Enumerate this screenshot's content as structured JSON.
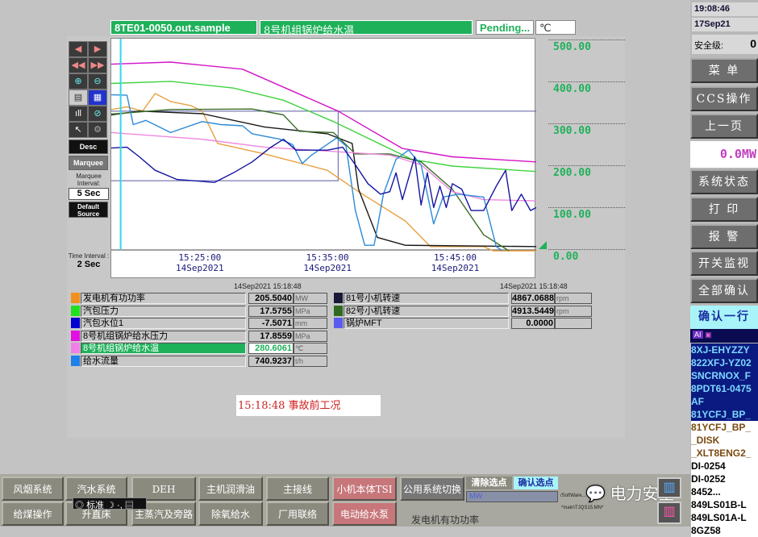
{
  "header": {
    "tag": "8TE01-0050.out.sample",
    "description": "8号机组锅炉给水温",
    "status": "Pending...",
    "unit": "℃"
  },
  "toolbar": {
    "desc": "Desc",
    "marquee": "Marquee",
    "marquee_interval_label": "Marquee Interval:",
    "marquee_interval": "5 Sec",
    "default_source": "Default Source",
    "time_interval_label": "Time Interval :",
    "time_interval": "2 Sec"
  },
  "chart_data": {
    "type": "line",
    "ylim": [
      0,
      500
    ],
    "xlim": [
      "15:18:00",
      "15:51:17"
    ],
    "y_ticks": [
      "0.00",
      "100.00",
      "200.00",
      "300.00",
      "400.00",
      "500.00"
    ],
    "x_ticks": [
      {
        "time": "15:25:00",
        "date": "14Sep2021"
      },
      {
        "time": "15:35:00",
        "date": "14Sep2021"
      },
      {
        "time": "15:45:00",
        "date": "14Sep2021"
      }
    ],
    "cursor_time": "15:18:44",
    "series": [
      {
        "name": "8号机组锅炉给水压力",
        "color": "#d214c8",
        "points": [
          [
            "15:18:00",
            445
          ],
          [
            "15:22:39",
            450
          ],
          [
            "15:28:17",
            433
          ],
          [
            "15:35:46",
            333
          ],
          [
            "15:40:48",
            244
          ],
          [
            "15:44:43",
            224
          ],
          [
            "15:51:17",
            212
          ]
        ]
      },
      {
        "name": "汽包压力",
        "color": "#3fd23f",
        "points": [
          [
            "15:18:00",
            399
          ],
          [
            "15:22:39",
            404
          ],
          [
            "15:27:34",
            388
          ],
          [
            "15:31:29",
            359
          ],
          [
            "15:35:24",
            308
          ],
          [
            "15:41:32",
            218
          ],
          [
            "15:44:43",
            202
          ],
          [
            "15:51:17",
            189
          ]
        ]
      },
      {
        "name": "发电机有功功率",
        "color": "#e8a040",
        "points": [
          [
            "15:18:00",
            337
          ],
          [
            "15:19:14",
            343
          ],
          [
            "15:20:27",
            333
          ],
          [
            "15:21:26",
            375
          ],
          [
            "15:22:39",
            356
          ],
          [
            "15:24:15",
            346
          ],
          [
            "15:25:07",
            333
          ],
          [
            "15:26:20",
            256
          ],
          [
            "15:30:01",
            231
          ],
          [
            "15:34:55",
            192
          ],
          [
            "15:37:22",
            141
          ],
          [
            "15:41:02",
            71
          ],
          [
            "15:43:00",
            10
          ],
          [
            "15:47:10",
            10
          ],
          [
            "15:47:54",
            0
          ],
          [
            "15:51:17",
            0
          ]
        ]
      },
      {
        "name": "81号小机转速",
        "color": "#1a1a1a",
        "points": [
          [
            "15:18:00",
            324
          ],
          [
            "15:20:12",
            333
          ],
          [
            "15:25:07",
            327
          ],
          [
            "15:30:01",
            295
          ],
          [
            "15:34:55",
            279
          ],
          [
            "15:36:52",
            256
          ],
          [
            "15:37:22",
            147
          ],
          [
            "15:38:50",
            32
          ],
          [
            "15:41:02",
            13
          ],
          [
            "15:51:17",
            10
          ]
        ]
      },
      {
        "name": "82号小机转速",
        "color": "#3c6e28",
        "points": [
          [
            "15:18:00",
            326
          ],
          [
            "15:22:39",
            337
          ],
          [
            "15:29:02",
            338
          ],
          [
            "15:31:29",
            324
          ],
          [
            "15:32:42",
            285
          ],
          [
            "15:35:24",
            282
          ],
          [
            "15:37:07",
            231
          ],
          [
            "15:39:49",
            231
          ],
          [
            "15:42:16",
            212
          ],
          [
            "15:44:43",
            147
          ],
          [
            "15:47:10",
            38
          ],
          [
            "15:49:08",
            0
          ]
        ]
      },
      {
        "name": "8号机组锅炉给水温",
        "color": "#ee88e0",
        "points": [
          [
            "15:18:00",
            282
          ],
          [
            "15:25:07",
            266
          ],
          [
            "15:30:01",
            247
          ],
          [
            "15:36:52",
            234
          ],
          [
            "15:39:49",
            228
          ],
          [
            "15:42:16",
            205
          ],
          [
            "15:44:43",
            141
          ],
          [
            "15:47:10",
            122
          ],
          [
            "15:51:17",
            119
          ]
        ]
      },
      {
        "name": "给水流量",
        "color": "#2a8ad8",
        "points": [
          [
            "15:18:00",
            372
          ],
          [
            "15:19:14",
            371
          ],
          [
            "15:19:43",
            301
          ],
          [
            "15:20:42",
            311
          ],
          [
            "15:22:39",
            282
          ],
          [
            "15:25:07",
            308
          ],
          [
            "15:26:35",
            301
          ],
          [
            "15:28:17",
            298
          ],
          [
            "15:29:02",
            279
          ],
          [
            "15:31:14",
            266
          ],
          [
            "15:32:13",
            253
          ],
          [
            "15:32:57",
            208
          ],
          [
            "15:33:41",
            228
          ],
          [
            "15:35:39",
            269
          ],
          [
            "15:36:23",
            250
          ],
          [
            "15:37:07",
            96
          ],
          [
            "15:37:51",
            13
          ],
          [
            "15:38:35",
            13
          ],
          [
            "15:39:19",
            135
          ],
          [
            "15:40:18",
            218
          ],
          [
            "15:41:17",
            240
          ],
          [
            "15:42:16",
            205
          ],
          [
            "15:43:15",
            64
          ],
          [
            "15:43:59",
            128
          ],
          [
            "15:45:12",
            135
          ],
          [
            "15:47:10",
            128
          ],
          [
            "15:48:09",
            10
          ],
          [
            "15:48:38",
            0
          ]
        ]
      },
      {
        "name": "汽包水位1",
        "color": "#1414a0",
        "points": [
          [
            "15:18:00",
            245
          ],
          [
            "15:19:14",
            247
          ],
          [
            "15:20:12",
            224
          ],
          [
            "15:21:26",
            192
          ],
          [
            "15:23:09",
            170
          ],
          [
            "15:26:05",
            163
          ],
          [
            "15:27:34",
            186
          ],
          [
            "15:29:02",
            212
          ],
          [
            "15:30:30",
            247
          ],
          [
            "15:31:29",
            266
          ],
          [
            "15:32:28",
            240
          ],
          [
            "15:34:55",
            240
          ],
          [
            "15:36:08",
            247
          ],
          [
            "15:37:07",
            205
          ],
          [
            "15:38:06",
            160
          ],
          [
            "15:39:05",
            135
          ],
          [
            "15:39:49",
            141
          ],
          [
            "15:40:18",
            186
          ],
          [
            "15:40:48",
            122
          ],
          [
            "15:41:46",
            224
          ],
          [
            "15:42:16",
            109
          ],
          [
            "15:42:45",
            186
          ],
          [
            "15:43:15",
            103
          ],
          [
            "15:43:44",
            154
          ],
          [
            "15:44:14",
            103
          ],
          [
            "15:44:43",
            160
          ],
          [
            "15:45:27",
            147
          ],
          [
            "15:46:11",
            96
          ],
          [
            "15:47:10",
            96
          ],
          [
            "15:48:09",
            154
          ],
          [
            "15:48:53",
            192
          ],
          [
            "15:49:22",
            96
          ],
          [
            "15:50:07",
            135
          ],
          [
            "15:50:50",
            96
          ],
          [
            "15:51:17",
            103
          ]
        ]
      }
    ]
  },
  "legend": {
    "timestamp_left": "14Sep2021  15:18:48",
    "timestamp_right": "14Sep2021  15:18:48",
    "left": [
      {
        "name": "发电机有功功率",
        "value": "205.5040",
        "unit": "MW",
        "color": "#f09020"
      },
      {
        "name": "汽包压力",
        "value": "17.5755",
        "unit": "MPa",
        "color": "#20e020"
      },
      {
        "name": "汽包水位1",
        "value": "-7.5071",
        "unit": "mm",
        "color": "#0000d0"
      },
      {
        "name": "8号机组锅炉给水压力",
        "value": "17.8559",
        "unit": "MPa",
        "color": "#e010e0"
      },
      {
        "name": "8号机组锅炉给水温",
        "value": "280.6061",
        "unit": "℃",
        "color": "#f080e8"
      },
      {
        "name": "给水流量",
        "value": "740.9237",
        "unit": "t/h",
        "color": "#1e80e8"
      }
    ],
    "right": [
      {
        "name": "81号小机转速",
        "value": "4867.0688",
        "unit": "rpm",
        "color": "#181838"
      },
      {
        "name": "82号小机转速",
        "value": "4913.5449",
        "unit": "rpm",
        "color": "#2e6a20"
      },
      {
        "name": "锅炉MFT",
        "value": "0.0000",
        "unit": "",
        "color": "#5a5af0"
      }
    ]
  },
  "note": "15:18:48  事故前工况",
  "sidebar": {
    "time": "19:08:46",
    "date": "17Sep21",
    "safety_label": "安全级:",
    "safety_value": "0",
    "buttons": [
      "菜 单",
      "CCS操作",
      "上一页"
    ],
    "power": "0.0MW",
    "buttons2": [
      "系统状态",
      "打 印",
      "报 警",
      "开关监视",
      "全部确认"
    ],
    "ack_row": "确认一行",
    "alarm_header": "AI",
    "alarms_selected": [
      "8XJ-EHYZZY",
      "822XFJ-YZ02",
      "SNCRNOX_F",
      "8PDT61-0475",
      "AF",
      "81YCFJ_BP_"
    ],
    "alarms": [
      "81YCFJ_BP_",
      "_DISK",
      "_XLT8ENG2_",
      "DI-0254",
      "DI-0252",
      "8452...",
      "849LS01B-L",
      "849LS01A-L",
      "8GZ58"
    ]
  },
  "bottom": {
    "row1": [
      "风烟系统",
      "汽水系统",
      "DEH",
      "主机润滑油",
      "主接线",
      "小机本体TSI",
      "公用系统切换"
    ],
    "row2": [
      "给煤操作",
      "升直床",
      "主蒸汽及旁路",
      "除氧给水",
      "厂用联络",
      "电动给水泵"
    ],
    "clear_points": "清除选点",
    "confirm_points": "确认选点",
    "unit_field": "MW",
    "path1": "/SoftWare...",
    "path2": "*main\\TJQS15.MN*",
    "selected_point": "发电机有功功率",
    "ime": "标准",
    "watermark": "电力安全"
  }
}
